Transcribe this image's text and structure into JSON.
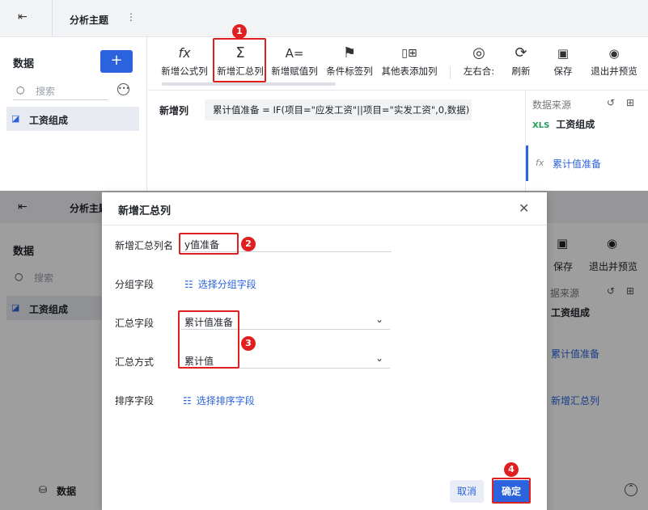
{
  "top": {
    "title": "分析主题",
    "sidebar": {
      "header": "数据",
      "add_label": "+",
      "search_placeholder": "搜索",
      "dataset": "工资组成"
    },
    "toolbar": {
      "items": [
        {
          "label": "新增公式列",
          "icon": "fx-icon",
          "glyph": "fx"
        },
        {
          "label": "新增汇总列",
          "icon": "sigma-icon",
          "glyph": "Σ"
        },
        {
          "label": "新增赋值列",
          "icon": "assign-icon",
          "glyph": "A="
        },
        {
          "label": "条件标签列",
          "icon": "flag-icon",
          "glyph": "⚑"
        },
        {
          "label": "其他表添加列",
          "icon": "add-column-icon",
          "glyph": "▯⊞"
        },
        {
          "label": "左右合:",
          "icon": "merge-icon",
          "glyph": "◎"
        },
        {
          "label": "刷新",
          "icon": "refresh-icon",
          "glyph": "⟳"
        },
        {
          "label": "保存",
          "icon": "save-icon",
          "glyph": "▣"
        },
        {
          "label": "退出并预览",
          "icon": "preview-icon",
          "glyph": "◉"
        }
      ]
    },
    "formula": {
      "label": "新增列",
      "expression": "累计值准备 = IF(项目=\"应发工资\"||项目=\"实发工资\",0,数据)"
    },
    "right_panel": {
      "title": "数据来源",
      "dataset": "工资组成",
      "dataset_badge": "XLS",
      "field": "累计值准备",
      "field_glyph": "fx"
    }
  },
  "bottom": {
    "title": "分析主题",
    "sidebar": {
      "header": "数据",
      "search_placeholder": "搜索",
      "dataset": "工资组成",
      "footer": "数据"
    },
    "right_toolbar": {
      "save": "保存",
      "exit_preview": "退出并预览"
    },
    "right_panel": {
      "title": "据来源",
      "dataset": "工资组成",
      "field": "累计值准备",
      "new_field": "新增汇总列"
    }
  },
  "dialog": {
    "title": "新增汇总列",
    "name_label": "新增汇总列名",
    "name_value": "y值准备",
    "group_label": "分组字段",
    "group_action": "选择分组字段",
    "agg_field_label": "汇总字段",
    "agg_field_value": "累计值准备",
    "agg_method_label": "汇总方式",
    "agg_method_value": "累计值",
    "sort_label": "排序字段",
    "sort_action": "选择排序字段",
    "cancel": "取消",
    "ok": "确定"
  },
  "steps": [
    "1",
    "2",
    "3",
    "4"
  ],
  "colors": {
    "accent": "#2b62dd",
    "annotation": "#e02020"
  }
}
